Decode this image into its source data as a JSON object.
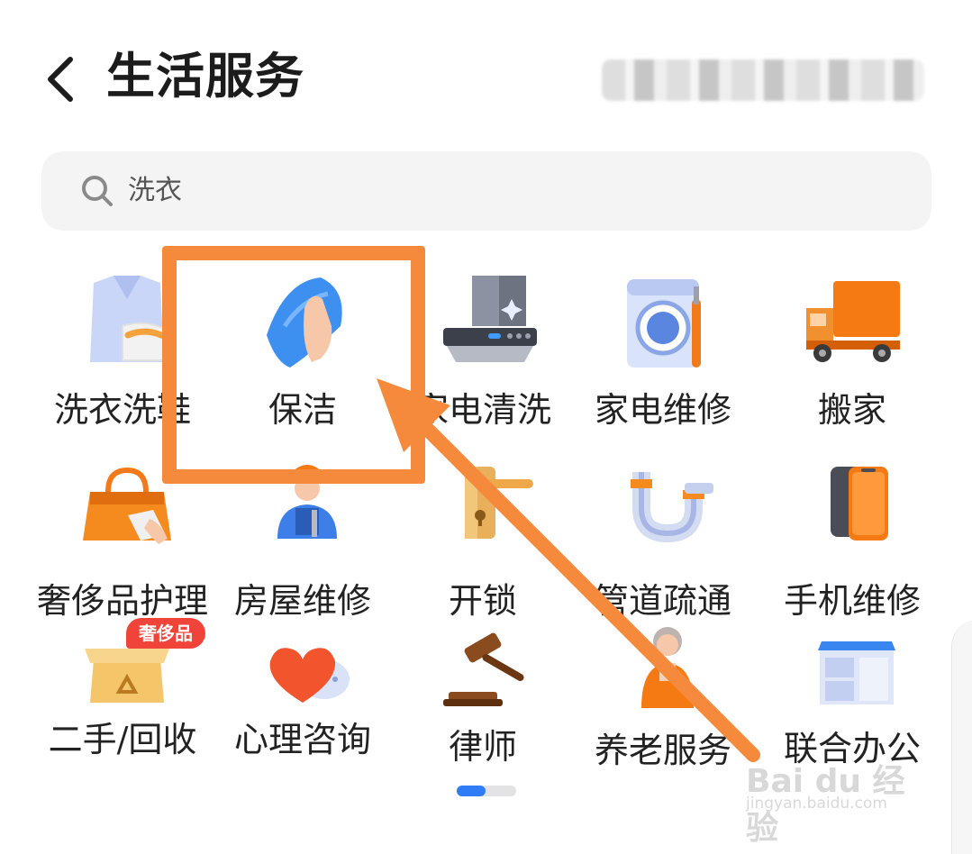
{
  "header": {
    "title": "生活服务",
    "back_icon": "chevron-left-icon"
  },
  "search": {
    "value": "洗衣",
    "icon": "search-icon"
  },
  "services": [
    {
      "label": "洗衣洗鞋",
      "icon": "shirt-shoe-icon"
    },
    {
      "label": "保洁",
      "icon": "cleaning-cloth-icon"
    },
    {
      "label": "家电清洗",
      "icon": "range-hood-icon"
    },
    {
      "label": "家电维修",
      "icon": "washing-machine-icon"
    },
    {
      "label": "搬家",
      "icon": "moving-truck-icon"
    },
    {
      "label": "奢侈品护理",
      "icon": "handbag-icon"
    },
    {
      "label": "房屋维修",
      "icon": "repair-worker-icon"
    },
    {
      "label": "开锁",
      "icon": "door-lock-icon"
    },
    {
      "label": "管道疏通",
      "icon": "pipe-icon"
    },
    {
      "label": "手机维修",
      "icon": "phone-icon"
    },
    {
      "label": "二手/回收",
      "icon": "recycle-box-icon",
      "badge": "奢侈品"
    },
    {
      "label": "心理咨询",
      "icon": "heart-chat-icon"
    },
    {
      "label": "律师",
      "icon": "gavel-icon"
    },
    {
      "label": "养老服务",
      "icon": "elderly-icon"
    },
    {
      "label": "联合办公",
      "icon": "desk-icon"
    }
  ],
  "pager": {
    "pages": 2,
    "current": 1
  },
  "annotation": {
    "highlight_color": "#f58a3c",
    "arrow_color": "#f58a3c"
  },
  "watermark": {
    "logo": "Bai du 经验",
    "url": "jingyan.baidu.com"
  },
  "colors": {
    "accent": "#2f7cf6",
    "badge": "#f0433a",
    "search_bg": "#f4f4f5"
  }
}
